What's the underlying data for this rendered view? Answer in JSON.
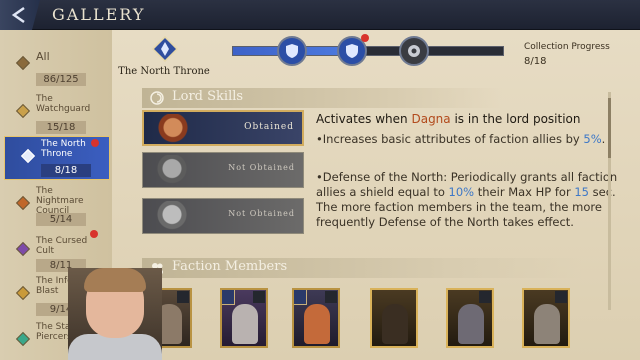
{
  "header": {
    "title": "GALLERY"
  },
  "sidebar": {
    "items": [
      {
        "label": "All",
        "count": "86/125"
      },
      {
        "label": "The Watchguard",
        "count": "15/18"
      },
      {
        "label": "The North Throne",
        "count": "8/18"
      },
      {
        "label": "The Nightmare Council",
        "count": "5/14"
      },
      {
        "label": "The Cursed Cult",
        "count": "8/11"
      },
      {
        "label": "The Inferno Blast",
        "count": "9/14"
      },
      {
        "label": "The Star Piercers",
        "count": ""
      }
    ]
  },
  "faction": {
    "name": "The North Throne",
    "progress_label": "Collection Progress",
    "progress_value": "8/18",
    "progress_fraction": 0.44
  },
  "lord_skills": {
    "title": "Lord Skills",
    "cards": [
      {
        "status": "Obtained"
      },
      {
        "status": "Not Obtained"
      },
      {
        "status": "Not Obtained"
      }
    ],
    "lead_prefix": "Activates when ",
    "lead_lord": "Dagna",
    "lead_suffix": " is in the lord position",
    "b1_pre": "•Increases basic attributes of faction allies by ",
    "b1_val": "5%",
    "b1_post": ".",
    "b2_pre": "•Defense of the North: Periodically grants all faction allies a shield equal to ",
    "b2_val1": "10%",
    "b2_mid": " their Max HP for ",
    "b2_val2": "15",
    "b2_post": " sec. The more faction members in the team, the more frequently Defense of the North takes effect."
  },
  "members": {
    "title": "Faction Members",
    "count_shown": 7
  },
  "colors": {
    "accent_blue": "#3b5ec0",
    "gold": "#d2ac5e",
    "highlight": "#3e78c7",
    "lord_name": "#b24a1c"
  }
}
